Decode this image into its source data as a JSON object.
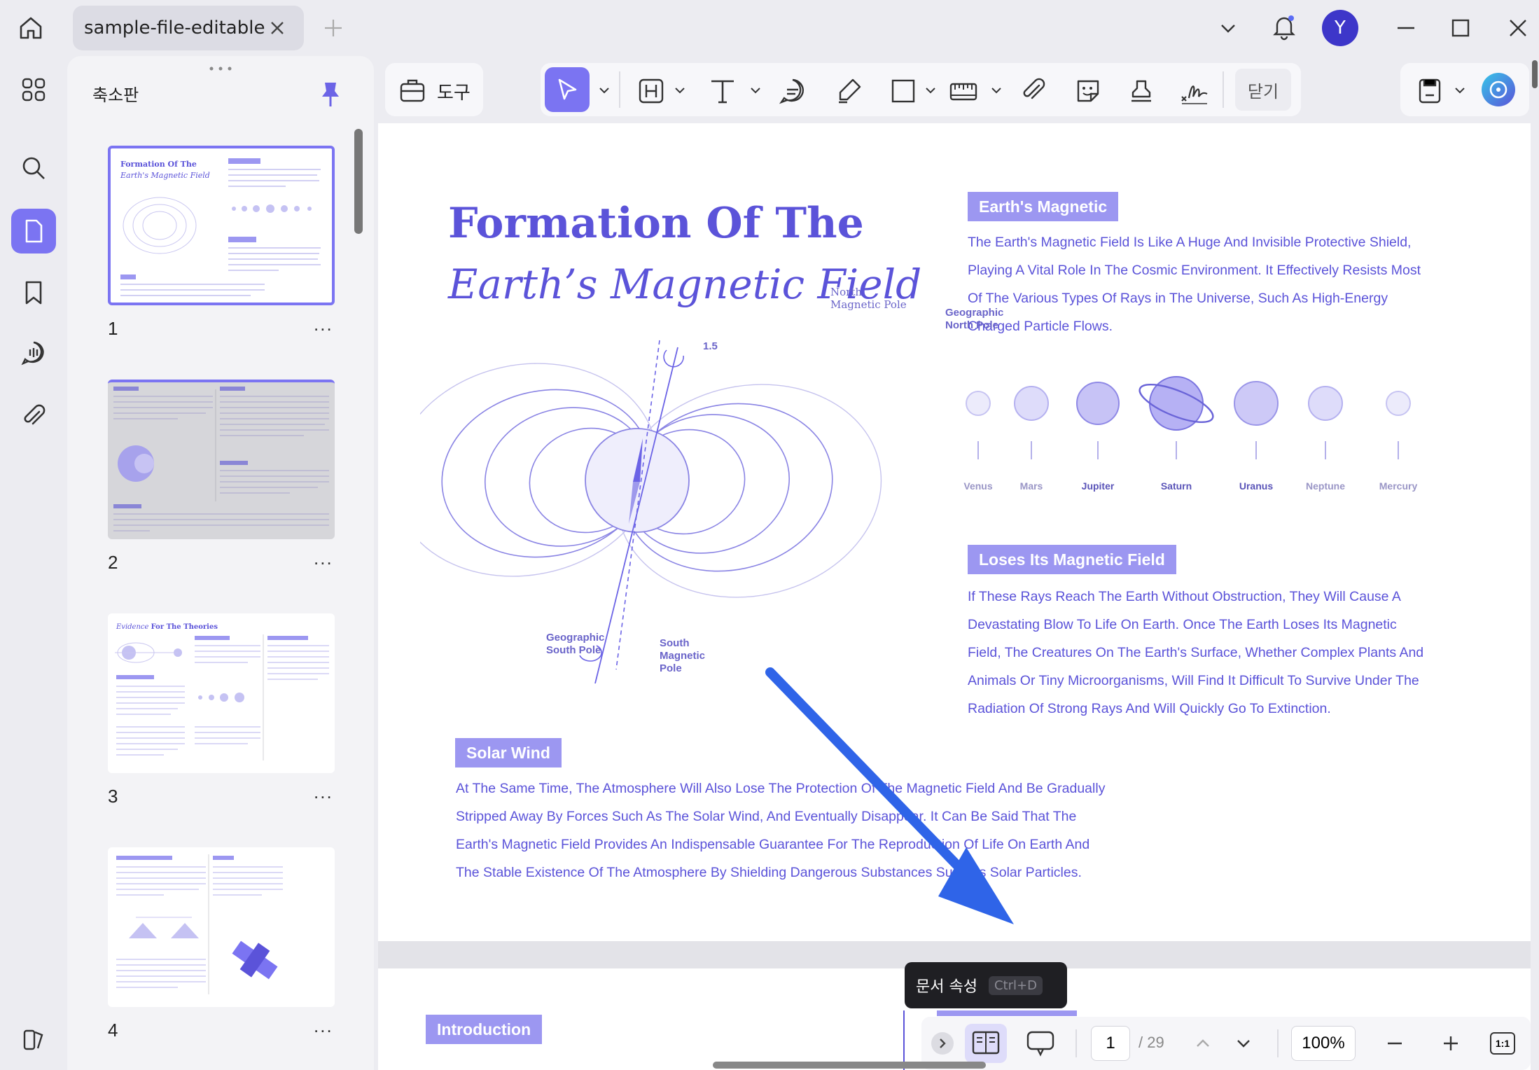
{
  "tab": {
    "title": "sample-file-editable"
  },
  "user": {
    "avatar_letter": "Y"
  },
  "panel": {
    "title": "축소판"
  },
  "thumbnails": [
    {
      "page": "1",
      "more": "..."
    },
    {
      "page": "2",
      "more": "..."
    },
    {
      "page": "3",
      "more": "..."
    },
    {
      "page": "4",
      "more": "..."
    }
  ],
  "thumb_texts": {
    "p3_title_a": "Evidence",
    "p3_title_b": "For The Theories"
  },
  "toolbar": {
    "tools_label": "도구",
    "close_label": "닫기"
  },
  "document": {
    "title_line1": "Formation Of The",
    "title_line2": "Earth’s Magnetic Field",
    "section1": {
      "heading": "Earth's Magnetic",
      "lines": [
        "The Earth's Magnetic Field Is Like A Huge And Invisible Protective Shield,",
        "Playing A Vital Role In The Cosmic Environment. It Effectively Resists Most",
        "Of The Various Types Of Rays in The Universe, Such As High-Energy",
        "Charged Particle Flows."
      ]
    },
    "planets": [
      "Venus",
      "Mars",
      "Jupiter",
      "Saturn",
      "Uranus",
      "Neptune",
      "Mercury"
    ],
    "section2": {
      "heading": "Loses Its Magnetic Field",
      "lines": [
        "If These Rays Reach The Earth Without Obstruction, They Will Cause A",
        "Devastating Blow To Life On Earth. Once The Earth Loses Its Magnetic",
        "Field, The Creatures On The Earth's Surface, Whether Complex Plants And",
        "Animals Or Tiny Microorganisms, Will Find It Difficult To Survive Under The",
        "Radiation Of Strong Rays And Will Quickly Go To Extinction."
      ]
    },
    "section3": {
      "heading": "Solar Wind",
      "lines": [
        "At The Same Time, The Atmosphere Will Also Lose The Protection Of The Magnetic Field And Be Gradually",
        "Stripped Away By Forces Such As The Solar Wind, And Eventually Disappear. It Can Be Said That The",
        "Earth's Magnetic Field Provides An Indispensable Guarantee For The Reproduction Of Life On Earth And",
        "The Stable Existence Of The Atmosphere By Shielding Dangerous Substances Such As Solar Particles."
      ]
    },
    "diagram": {
      "north_magnetic_1": "North",
      "north_magnetic_2": "Magnetic Pole",
      "geo_north_1": "Geographic",
      "geo_north_2": "North Pole",
      "angle": "1.5",
      "geo_south_1": "Geographic",
      "geo_south_2": "South Pole",
      "south_magnetic_1": "South",
      "south_magnetic_2": "Magnetic",
      "south_magnetic_3": "Pole"
    },
    "page2_heading": "Introduction"
  },
  "tooltip": {
    "label": "문서 속성",
    "shortcut": "Ctrl+D"
  },
  "pager": {
    "current": "1",
    "total": "/ 29",
    "zoom": "100%",
    "fit": "1:1"
  },
  "colors": {
    "accent": "#7b74f2",
    "doc_text": "#5b53d9",
    "tag_bg": "#9c97f1",
    "arrow": "#2f64e8"
  }
}
